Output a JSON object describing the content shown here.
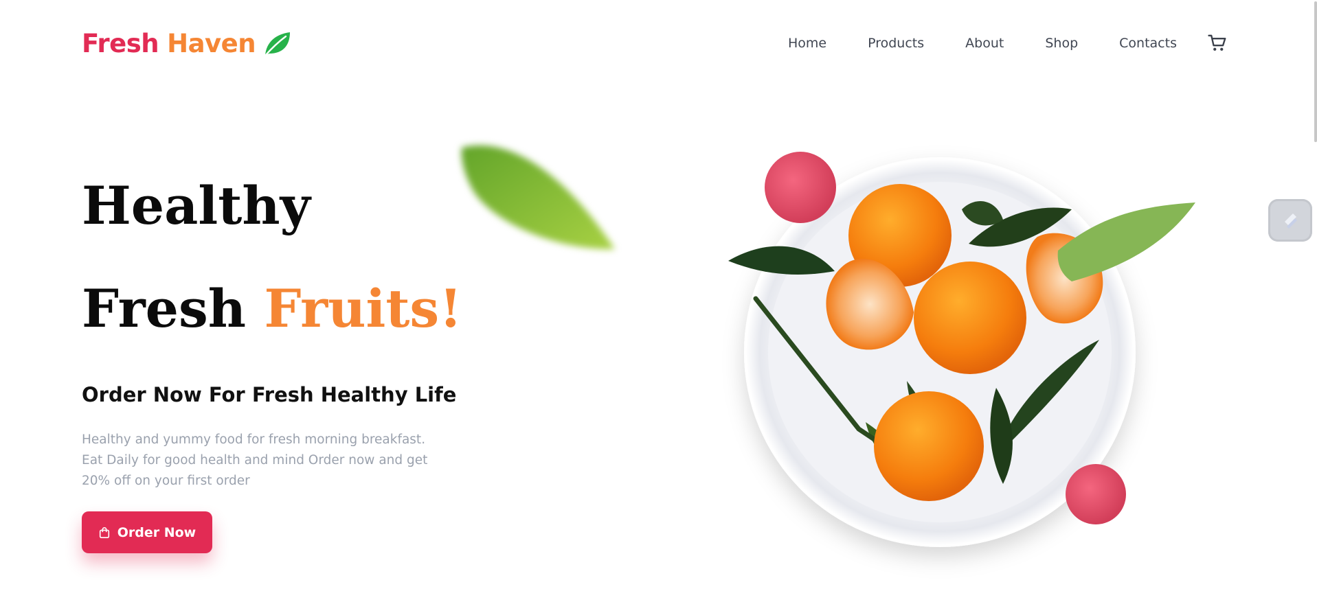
{
  "brand": {
    "word1": "Fresh",
    "word2": "Haven",
    "icon": "leaf-icon",
    "color1": "#e22b54",
    "color2": "#f58634",
    "leaf_color": "#27b24a"
  },
  "nav": {
    "items": [
      {
        "label": "Home"
      },
      {
        "label": "Products"
      },
      {
        "label": "About"
      },
      {
        "label": "Shop"
      },
      {
        "label": "Contacts"
      }
    ],
    "cart_icon": "cart-icon"
  },
  "hero": {
    "line1": "Healthy",
    "line2_a": "Fresh",
    "line2_b": "Fruits!",
    "subheading": "Order Now For Fresh Healthy Life",
    "description": "Healthy and yummy food for fresh morning breakfast. Eat Daily for good health and mind Order now and get 20% off on your first order",
    "cta_label": "Order Now",
    "cta_icon": "shopping-bag-icon",
    "accent_color": "#f58634",
    "button_color": "#e22b54"
  },
  "images": {
    "floating_leaf": "blurred-leaf",
    "plate": "plate-of-oranges-with-leaves-and-raspberries"
  },
  "browser": {
    "extension_icon": "extension-icon"
  }
}
